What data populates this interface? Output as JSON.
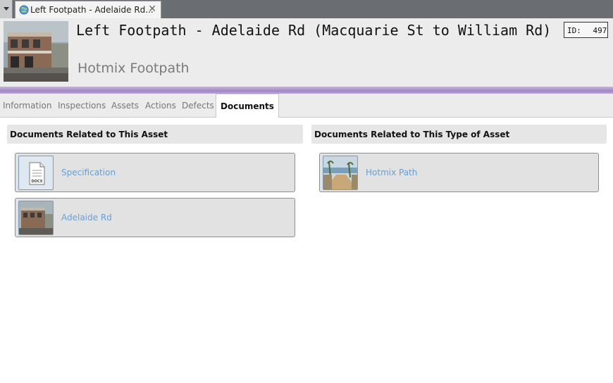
{
  "window": {
    "tab_title": "Left Footpath - Adelaide Rd...",
    "close_glyph": "✕",
    "tab_icon": "globe-icon"
  },
  "header": {
    "title": "Left Footpath - Adelaide Rd (Macquarie St to William Rd)",
    "subtitle": "Hotmix Footpath",
    "id_label": "ID:",
    "id_value": "497"
  },
  "tabs": [
    {
      "label": "Information"
    },
    {
      "label": "Inspections"
    },
    {
      "label": "Assets"
    },
    {
      "label": "Actions"
    },
    {
      "label": "Defects"
    },
    {
      "label": "Documents",
      "active": true
    }
  ],
  "related_to_asset": {
    "heading": "Documents Related to This Asset",
    "documents": [
      {
        "label": "Specification",
        "icon": "docx-file-icon",
        "file_badge": "DOCX"
      },
      {
        "label": "Adelaide Rd",
        "icon": "building-photo-thumbnail"
      }
    ]
  },
  "related_to_type": {
    "heading": "Documents Related to This Type of Asset",
    "documents": [
      {
        "label": "Hotmix Path",
        "icon": "path-photo-thumbnail"
      }
    ]
  },
  "colors": {
    "accent_band": "#9f87c4",
    "link": "#6a9ed0",
    "header_bg": "#ececec"
  }
}
